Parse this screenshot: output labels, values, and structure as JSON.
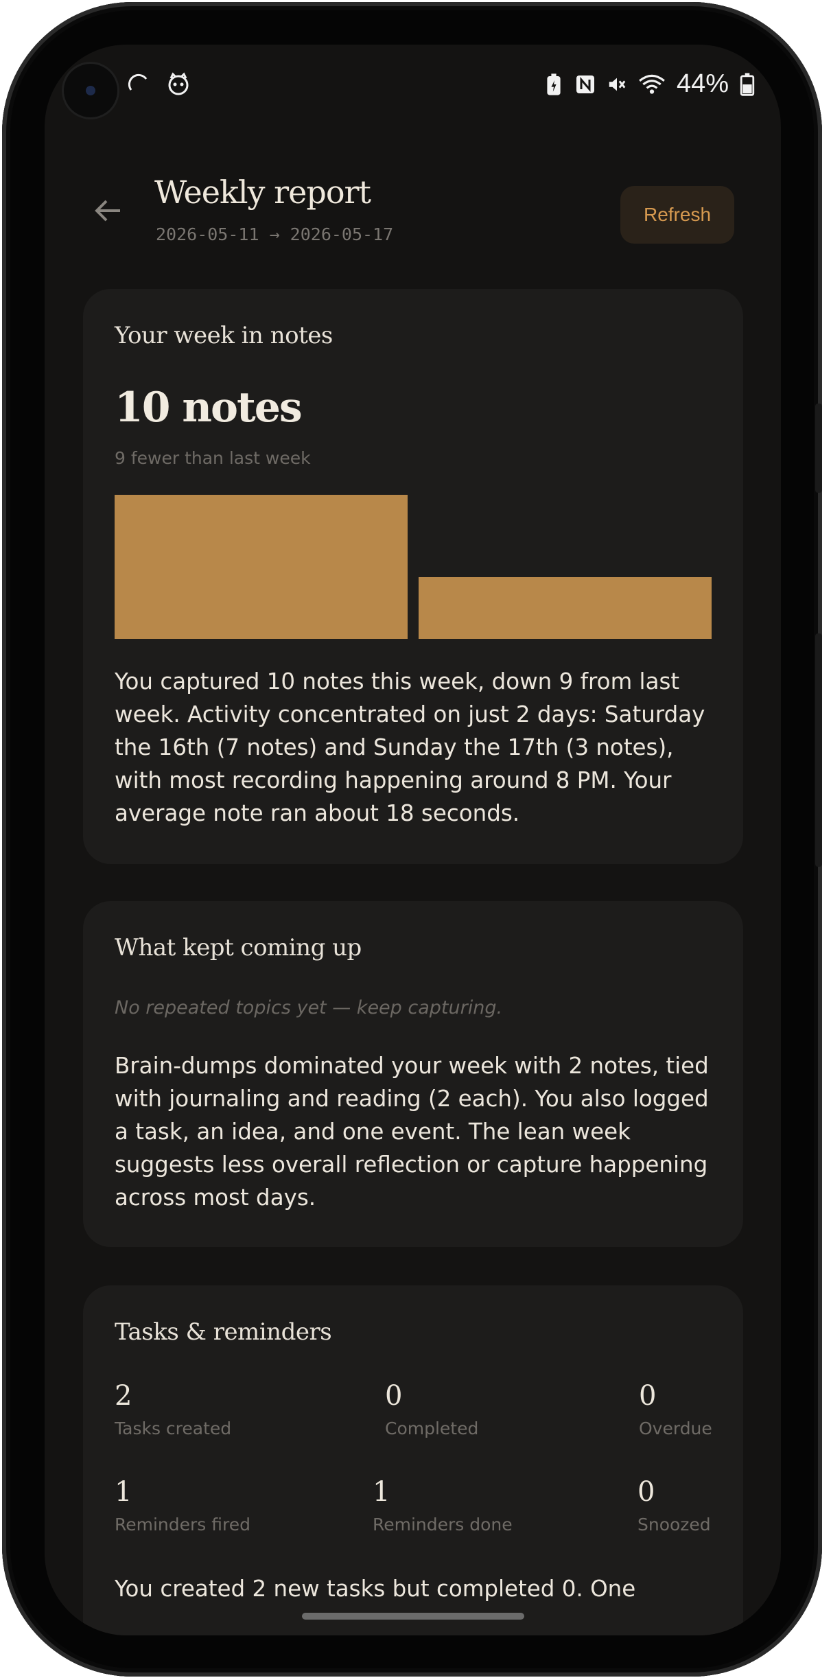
{
  "status_bar": {
    "left_icons": [
      "nfc-sync-icon",
      "cat-face-icon"
    ],
    "right_icons": [
      "battery-saver-icon",
      "nfc-icon",
      "vibrate-mute-icon",
      "wifi-icon"
    ],
    "battery_percent": "44%"
  },
  "header": {
    "title": "Weekly report",
    "date_range": "2026-05-11 → 2026-05-17",
    "refresh_label": "Refresh"
  },
  "notes_card": {
    "title": "Your week in notes",
    "count_label": "10 notes",
    "comparison": "9 fewer than last week",
    "bar_color": "#b8884a",
    "summary": "You captured 10 notes this week, down 9 from last week. Activity concentrated on just 2 days: Saturday the 16th (7 notes) and Sunday the 17th (3 notes), with most recording happening around 8 PM. Your average note ran about 18 seconds."
  },
  "chart_data": {
    "type": "bar",
    "categories": [
      "",
      ""
    ],
    "values": [
      7,
      3
    ],
    "ylim": [
      0,
      7
    ],
    "xlabel": "",
    "ylabel": "",
    "title": "",
    "grid": false
  },
  "topics_card": {
    "title": "What kept coming up",
    "empty_state": "No repeated topics yet — keep capturing.",
    "summary": "Brain-dumps dominated your week with 2 notes, tied with journaling and reading (2 each). You also logged a task, an idea, and one event. The lean week suggests less overall reflection or capture happening across most days."
  },
  "tasks_card": {
    "title": "Tasks & reminders",
    "stats_row1": [
      {
        "value": "2",
        "label": "Tasks created"
      },
      {
        "value": "0",
        "label": "Completed"
      },
      {
        "value": "0",
        "label": "Overdue"
      }
    ],
    "stats_row2": [
      {
        "value": "1",
        "label": "Reminders fired"
      },
      {
        "value": "1",
        "label": "Reminders done"
      },
      {
        "value": "0",
        "label": "Snoozed"
      }
    ],
    "summary_partial": "You created 2 new tasks but completed 0. One"
  }
}
